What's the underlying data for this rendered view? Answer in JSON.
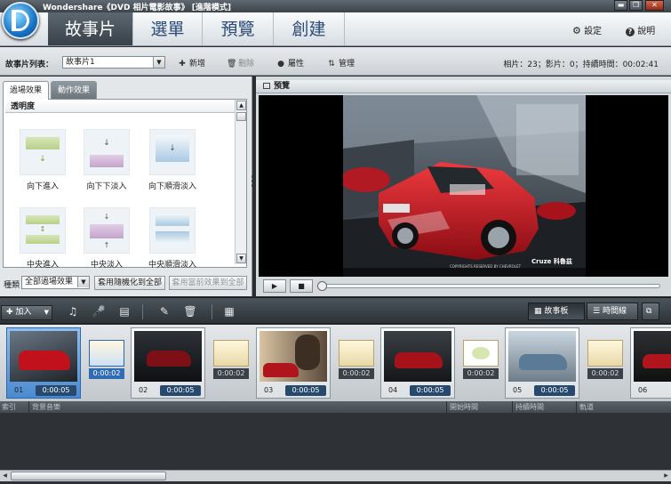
{
  "window": {
    "title": "Wondershare《DVD 相片電影故事》 [進階模式]",
    "min": "▬",
    "max": "❐",
    "close": "✕"
  },
  "nav": {
    "tabs": [
      "故事片",
      "選單",
      "預覽",
      "創建"
    ],
    "settings": "設定",
    "help": "說明",
    "settings_icon": "gear-icon",
    "help_icon": "help-icon"
  },
  "toolbar": {
    "list_label": "故事片列表：",
    "list_value": "故事片1",
    "buttons": {
      "new": "新增",
      "delete": "刪除",
      "properties": "屬性",
      "manage": "管理"
    },
    "stats": "相片：23；影片：0；持續時間：00:02:41"
  },
  "left": {
    "tabs": [
      "過場效果",
      "動作效果"
    ],
    "category": "透明度",
    "effects": [
      "向下進入",
      "向下下淡入",
      "向下順滑淡入",
      "中央進入",
      "中央淡入",
      "中央順滑淡入"
    ],
    "type_label": "種類",
    "type_value": "全部過場效果",
    "apply_random": "套用隨機化到全部",
    "apply_current": "套用當前效果到全部"
  },
  "preview": {
    "title": "預覽",
    "caption": "COPYRIGHTS RESERVED BY CHEVROLET",
    "brand": "Cruze 科魯茲"
  },
  "storyboard": {
    "add": "加入",
    "views": [
      "故事板",
      "時間線"
    ],
    "clips": [
      {
        "num": "01",
        "dur": "0:00:05"
      },
      {
        "num": "02",
        "dur": "0:00:05"
      },
      {
        "num": "03",
        "dur": "0:00:05"
      },
      {
        "num": "04",
        "dur": "0:00:05"
      },
      {
        "num": "05",
        "dur": "0:00:05"
      },
      {
        "num": "06",
        "dur": ""
      }
    ],
    "transitions": [
      "0:00:02",
      "0:00:02",
      "0:00:02",
      "0:00:02",
      "0:00:02"
    ]
  },
  "columns": [
    "索引",
    "背景音樂",
    "開始時間",
    "持續時間",
    "軌道"
  ],
  "colors": {
    "accent_blue": "#2f6cb5",
    "car_red": "#c5121f",
    "active_tab": "#3f4950"
  }
}
